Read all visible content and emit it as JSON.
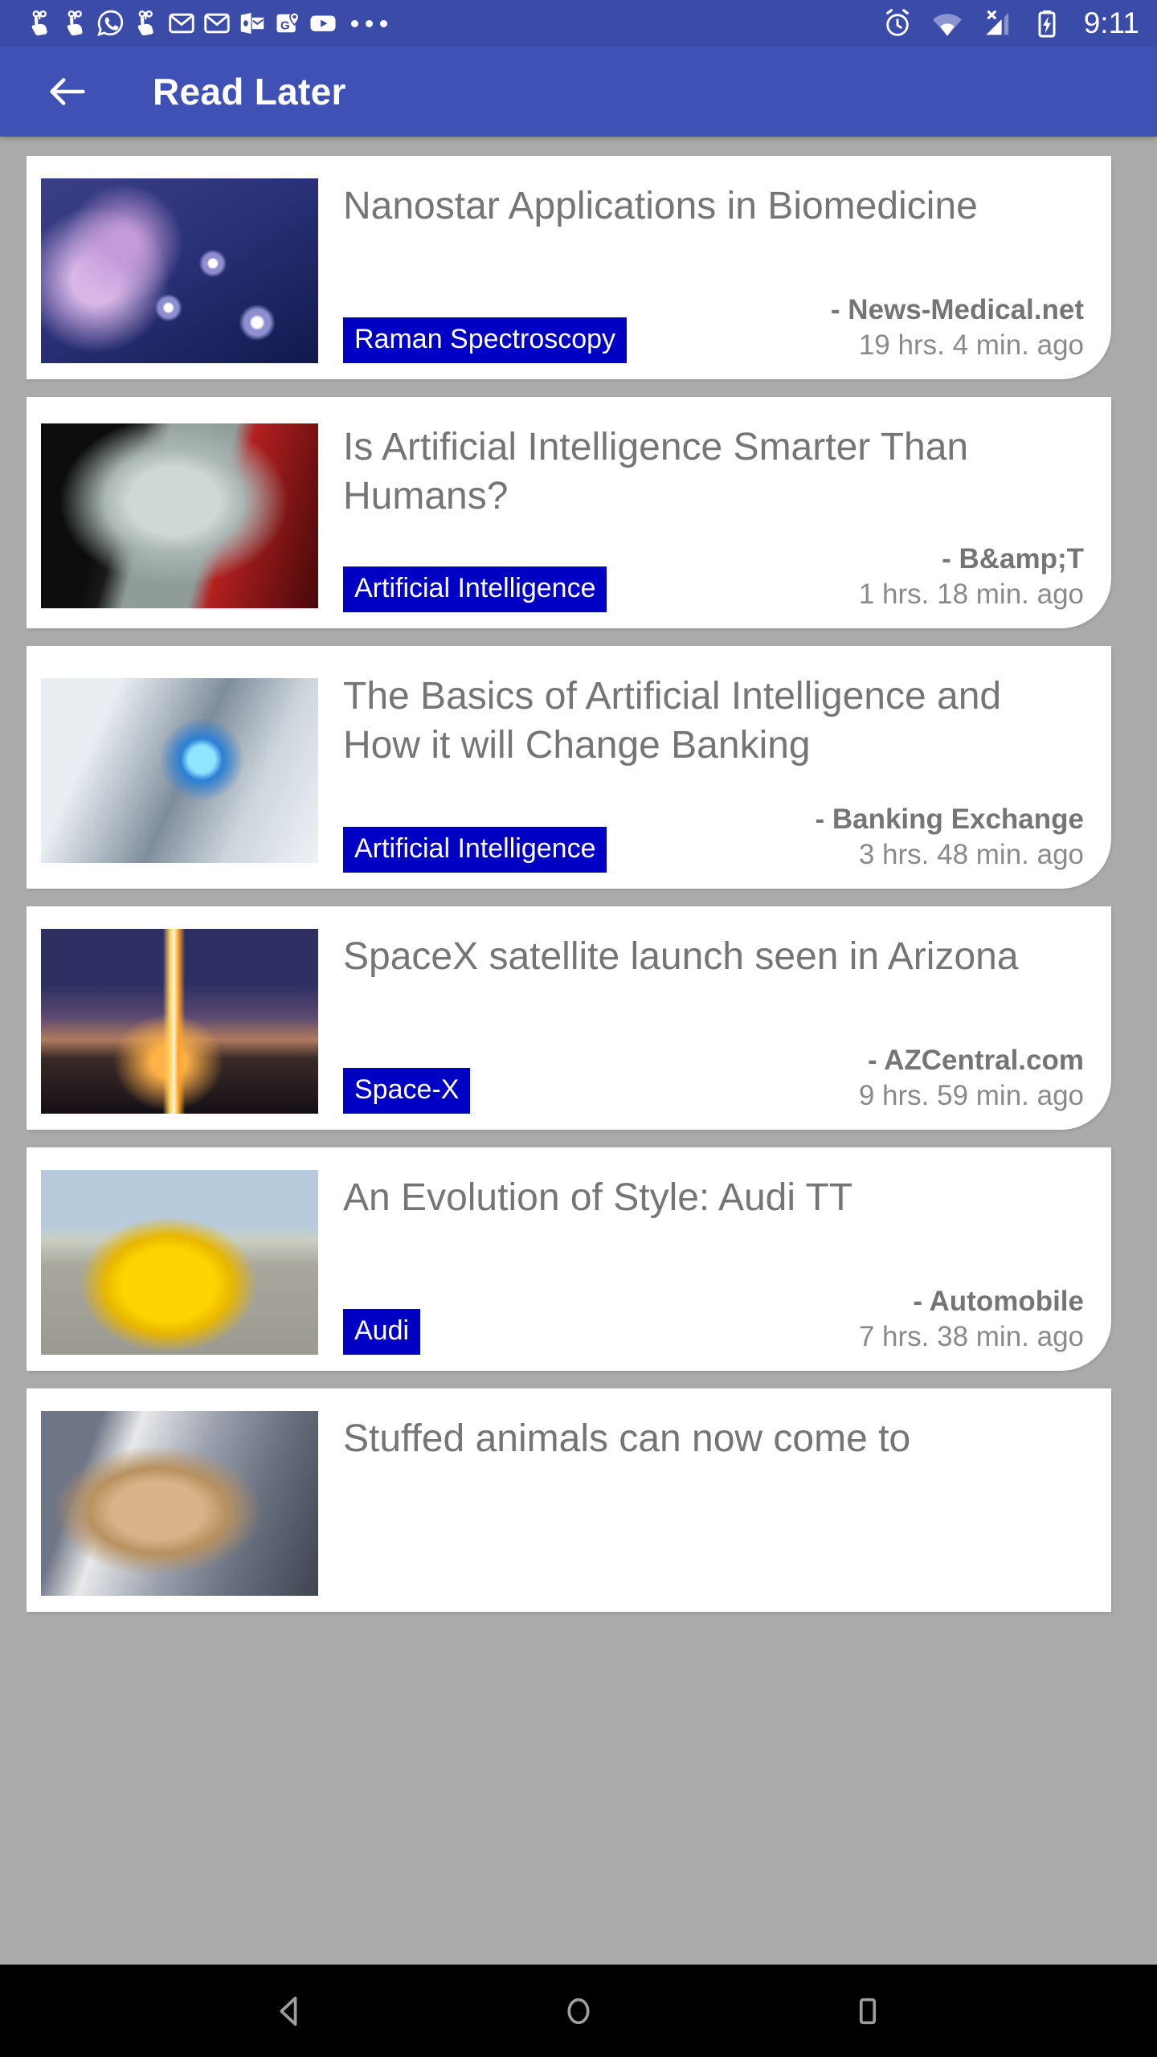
{
  "status_bar": {
    "background_color": "#3b4ba8",
    "time": "9:11",
    "notification_icons": [
      {
        "name": "tap-gesture-icon"
      },
      {
        "name": "tap-gesture-icon"
      },
      {
        "name": "whatsapp-icon"
      },
      {
        "name": "tap-gesture-icon"
      },
      {
        "name": "gmail-icon"
      },
      {
        "name": "gmail-icon"
      },
      {
        "name": "outlook-icon"
      },
      {
        "name": "google-maps-icon"
      },
      {
        "name": "youtube-icon"
      },
      {
        "name": "more-notifications-icon"
      }
    ],
    "system_icons": [
      {
        "name": "alarm-icon"
      },
      {
        "name": "wifi-icon"
      },
      {
        "name": "cellular-signal-off-icon"
      },
      {
        "name": "battery-charging-icon"
      }
    ]
  },
  "app_bar": {
    "background_color": "#3f51b5",
    "back_icon": "arrow-left-icon",
    "title": "Read Later"
  },
  "list": {
    "background_color": "#aaaaaa",
    "badge_color": "#0000c4",
    "title_color": "#757575",
    "articles": [
      {
        "title": "Nanostar Applications in Biomedicine",
        "tag": "Raman Spectroscopy",
        "source": "- News-Medical.net",
        "time": "19 hrs. 4 min. ago",
        "thumb_alt": "nanostar-particles-thumbnail"
      },
      {
        "title": "Is Artificial Intelligence Smarter Than Humans?",
        "tag": "Artificial Intelligence",
        "source": "- B&amp;T",
        "time": "1 hrs. 18 min. ago",
        "thumb_alt": "android-face-thumbnail"
      },
      {
        "title": "The Basics of Artificial Intelligence and How it will Change Banking",
        "tag": "Artificial Intelligence",
        "source": "- Banking Exchange",
        "time": "3 hrs. 48 min. ago",
        "thumb_alt": "robot-hand-thumbnail"
      },
      {
        "title": "SpaceX satellite launch seen in Arizona",
        "tag": "Space-X",
        "source": "- AZCentral.com",
        "time": "9 hrs. 59 min. ago",
        "thumb_alt": "rocket-launch-thumbnail"
      },
      {
        "title": "An Evolution of Style: Audi TT",
        "tag": "Audi",
        "source": "- Automobile",
        "time": "7 hrs. 38 min. ago",
        "thumb_alt": "yellow-audi-tt-thumbnail"
      },
      {
        "title": "Stuffed animals can now come to",
        "tag": "",
        "source": "",
        "time": "",
        "thumb_alt": "stuffed-animal-thumbnail"
      }
    ]
  },
  "nav_bar": {
    "background_color": "#000000",
    "buttons": [
      {
        "name": "back-button"
      },
      {
        "name": "home-button"
      },
      {
        "name": "recents-button"
      }
    ]
  }
}
